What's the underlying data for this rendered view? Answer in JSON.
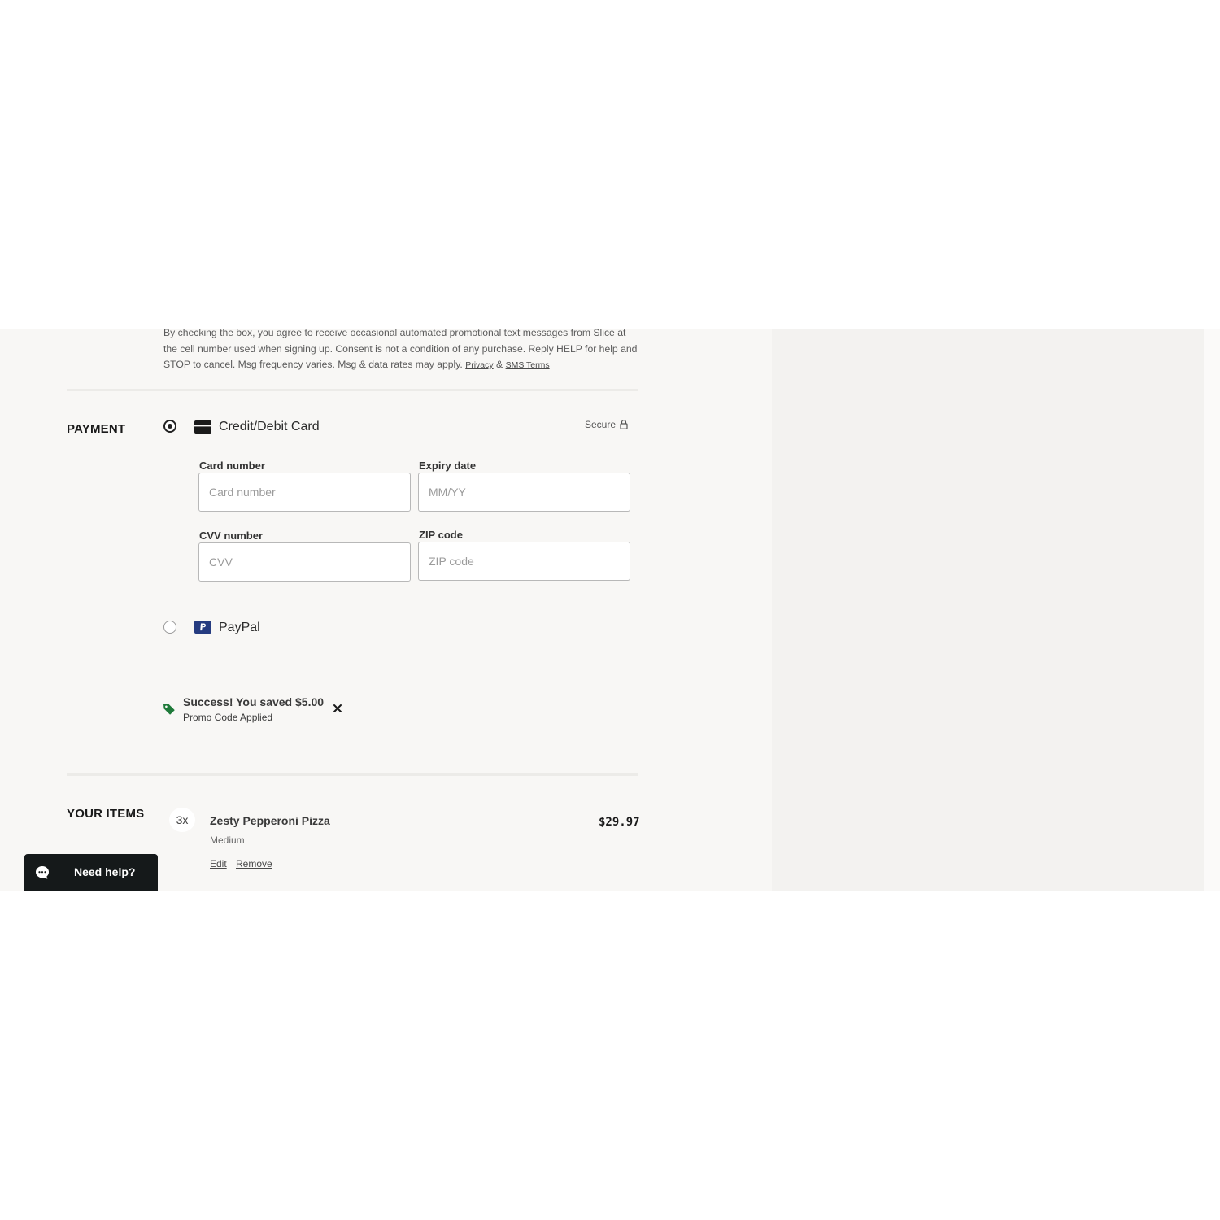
{
  "consent": {
    "text": "By checking the box, you agree to receive occasional automated promotional text messages from Slice at the cell number used when signing up. Consent is not a condition of any purchase. Reply HELP for help and STOP to cancel. Msg frequency varies. Msg & data rates may apply.",
    "privacy_link": "Privacy",
    "amp": "&",
    "sms_terms_link": "SMS Terms"
  },
  "payment": {
    "heading": "PAYMENT",
    "secure_label": "Secure",
    "methods": [
      {
        "label": "Credit/Debit Card",
        "selected": true,
        "icon": "credit-card-icon"
      },
      {
        "label": "PayPal",
        "selected": false,
        "icon": "paypal-icon"
      }
    ],
    "fields": {
      "card_number": {
        "label": "Card number",
        "placeholder": "Card number",
        "value": ""
      },
      "expiry": {
        "label": "Expiry date",
        "placeholder": "MM/YY",
        "value": ""
      },
      "cvv": {
        "label": "CVV number",
        "placeholder": "CVV",
        "value": ""
      },
      "zip": {
        "label": "ZIP code",
        "placeholder": "ZIP code",
        "value": ""
      }
    },
    "promo": {
      "title": "Success! You saved $5.00",
      "subtitle": "Promo Code Applied",
      "icon": "tag-icon"
    }
  },
  "items": {
    "heading": "YOUR ITEMS",
    "list": [
      {
        "qty": "3x",
        "name": "Zesty Pepperoni Pizza",
        "size": "Medium",
        "price": "$29.97",
        "edit_label": "Edit",
        "remove_label": "Remove"
      }
    ]
  },
  "help_widget": {
    "label": "Need help?",
    "icon": "chat-bubble-icon"
  },
  "colors": {
    "promo_green": "#1f7a3a",
    "paypal_blue": "#253b80",
    "help_bg": "#15191a"
  }
}
